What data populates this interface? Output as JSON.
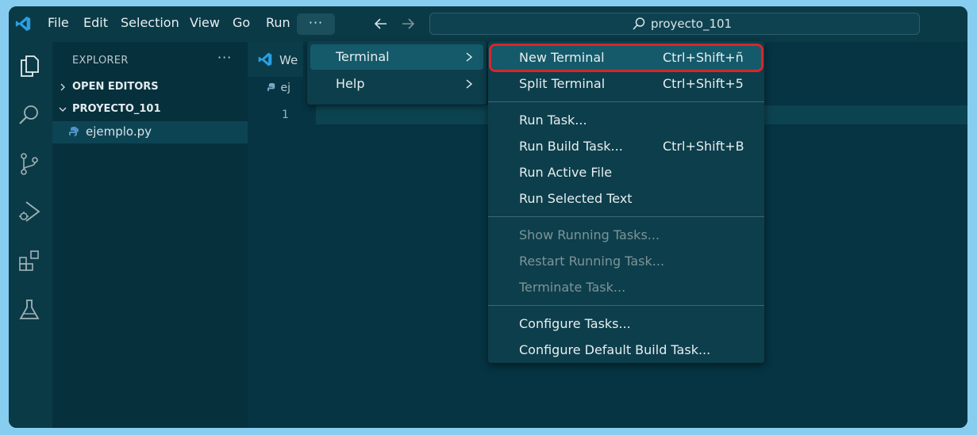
{
  "titlebar": {
    "menus": [
      "File",
      "Edit",
      "Selection",
      "View",
      "Go",
      "Run"
    ],
    "more_label": "···",
    "search_text": "proyecto_101"
  },
  "activity_bar": {
    "icons": [
      "explorer-icon",
      "search-icon",
      "source-control-icon",
      "run-debug-icon",
      "extensions-icon",
      "testing-icon"
    ]
  },
  "sidebar": {
    "title": "EXPLORER",
    "more_label": "···",
    "sections": [
      "OPEN EDITORS",
      "PROYECTO_101"
    ],
    "file": "ejemplo.py"
  },
  "editor": {
    "tab_label": "We",
    "breadcrumb": "ej",
    "line_number": "1"
  },
  "run_menu": {
    "items": [
      {
        "label": "Terminal",
        "has_submenu": true,
        "active": true
      },
      {
        "label": "Help",
        "has_submenu": true,
        "active": false
      }
    ]
  },
  "terminal_menu": {
    "groups": [
      [
        {
          "label": "New Terminal",
          "shortcut": "Ctrl+Shift+ñ",
          "highlighted": true
        },
        {
          "label": "Split Terminal",
          "shortcut": "Ctrl+Shift+5"
        }
      ],
      [
        {
          "label": "Run Task..."
        },
        {
          "label": "Run Build Task...",
          "shortcut": "Ctrl+Shift+B"
        },
        {
          "label": "Run Active File"
        },
        {
          "label": "Run Selected Text"
        }
      ],
      [
        {
          "label": "Show Running Tasks...",
          "disabled": true
        },
        {
          "label": "Restart Running Task...",
          "disabled": true
        },
        {
          "label": "Terminate Task...",
          "disabled": true
        }
      ],
      [
        {
          "label": "Configure Tasks..."
        },
        {
          "label": "Configure Default Build Task..."
        }
      ]
    ]
  },
  "colors": {
    "accent": "#155a6a",
    "highlight_border": "#d8262b",
    "background": "#06303c"
  }
}
